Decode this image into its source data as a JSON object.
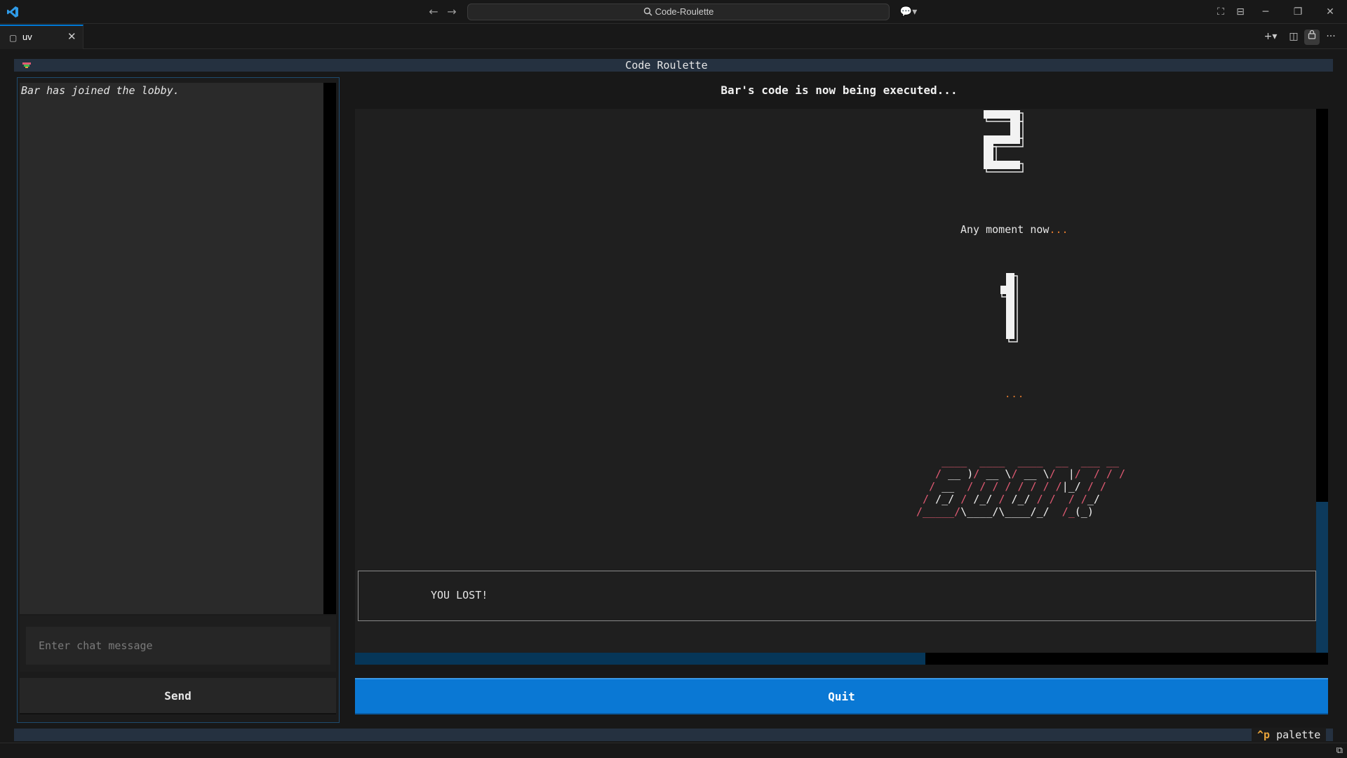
{
  "window": {
    "search_label": "Code-Roulette",
    "back_icon": "←",
    "forward_icon": "→"
  },
  "tab": {
    "label": "uv",
    "close_icon": "✕"
  },
  "tab_actions": {
    "new_icon": "+",
    "split_icon": "◫",
    "lock_icon": "🔒",
    "more_icon": "···"
  },
  "app": {
    "title": "Code Roulette"
  },
  "chat": {
    "messages": [
      "Bar has joined the lobby."
    ],
    "input_placeholder": "Enter chat message",
    "send_label": "Send"
  },
  "game": {
    "status": "Bar's code is now being executed...",
    "countdown_top": "2",
    "moment_text": "Any moment now",
    "moment_dots": "...",
    "countdown_bottom": "1",
    "ellipsis": "...",
    "result": "YOU LOST!",
    "progress_fraction": 0.586,
    "quit_label": "Quit"
  },
  "footer": {
    "key": "^p",
    "hint": " palette"
  },
  "colors": {
    "accent": "#0a78d4",
    "boom": "#e05a73",
    "dots": "#e07a2e"
  }
}
